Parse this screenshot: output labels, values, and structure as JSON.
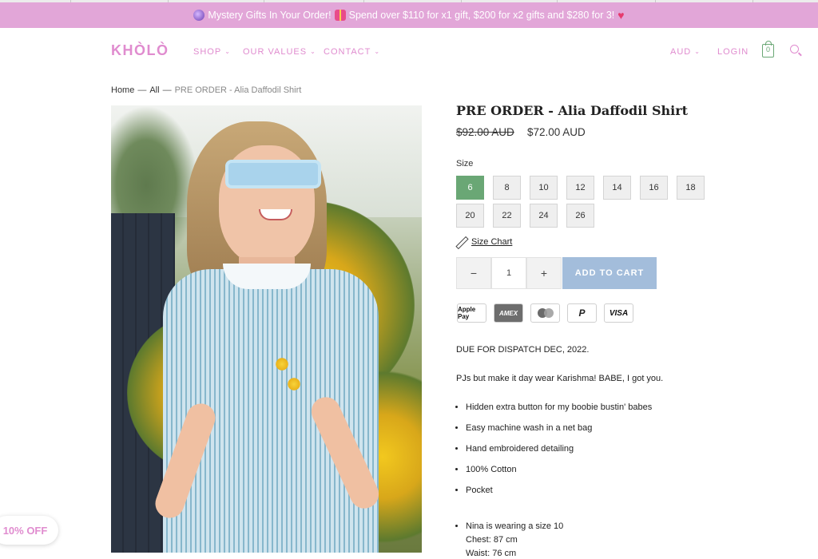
{
  "announcement": {
    "text": "Mystery Gifts In Your Order!",
    "text2": "Spend over $110 for x1 gift, $200 for x2 gifts and $280 for 3!",
    "icons": [
      "crystal-ball-icon",
      "gift-icon",
      "heart-gift-icon"
    ]
  },
  "nav": {
    "logo": "KHÒLÒ",
    "shop": "SHOP",
    "values": "OUR VALUES",
    "contact": "CONTACT",
    "currency": "AUD",
    "login": "LOGIN",
    "cart_count": "0"
  },
  "breadcrumb": {
    "home": "Home",
    "sep": "—",
    "all": "All",
    "current": "PRE ORDER - Alia Daffodil Shirt"
  },
  "product": {
    "title": "PRE ORDER - Alia Daffodil Shirt",
    "price_old": "$92.00 AUD",
    "price_new": "$72.00 AUD",
    "size_label": "Size",
    "sizes": [
      "6",
      "8",
      "10",
      "12",
      "14",
      "16",
      "18",
      "20",
      "22",
      "24",
      "26"
    ],
    "selected_size": "6",
    "size_chart": "Size Chart",
    "qty_minus": "−",
    "quantity": "1",
    "qty_plus": "+",
    "add_to_cart": "ADD TO CART",
    "payments": [
      "Apple Pay",
      "AMEX",
      "Mastercard",
      "PayPal",
      "VISA"
    ],
    "dispatch": "DUE FOR DISPATCH DEC, 2022.",
    "intro": "PJs but make it day wear Karishma! BABE, I got you.",
    "features": [
      "Hidden extra button for my boobie bustin' babes",
      "Easy machine wash in a net bag",
      "Hand embroidered detailing",
      "100% Cotton",
      "Pocket"
    ],
    "model_note": "Nina is wearing a size 10",
    "chest": "Chest: 87 cm",
    "waist": "Waist: 76 cm"
  },
  "promo": {
    "label": "10% OFF"
  },
  "colors": {
    "announce_bg": "#e2a6d8",
    "brand_pink": "#e08ccf",
    "selected_green": "#6aa775",
    "add_button": "#a3bddb"
  }
}
